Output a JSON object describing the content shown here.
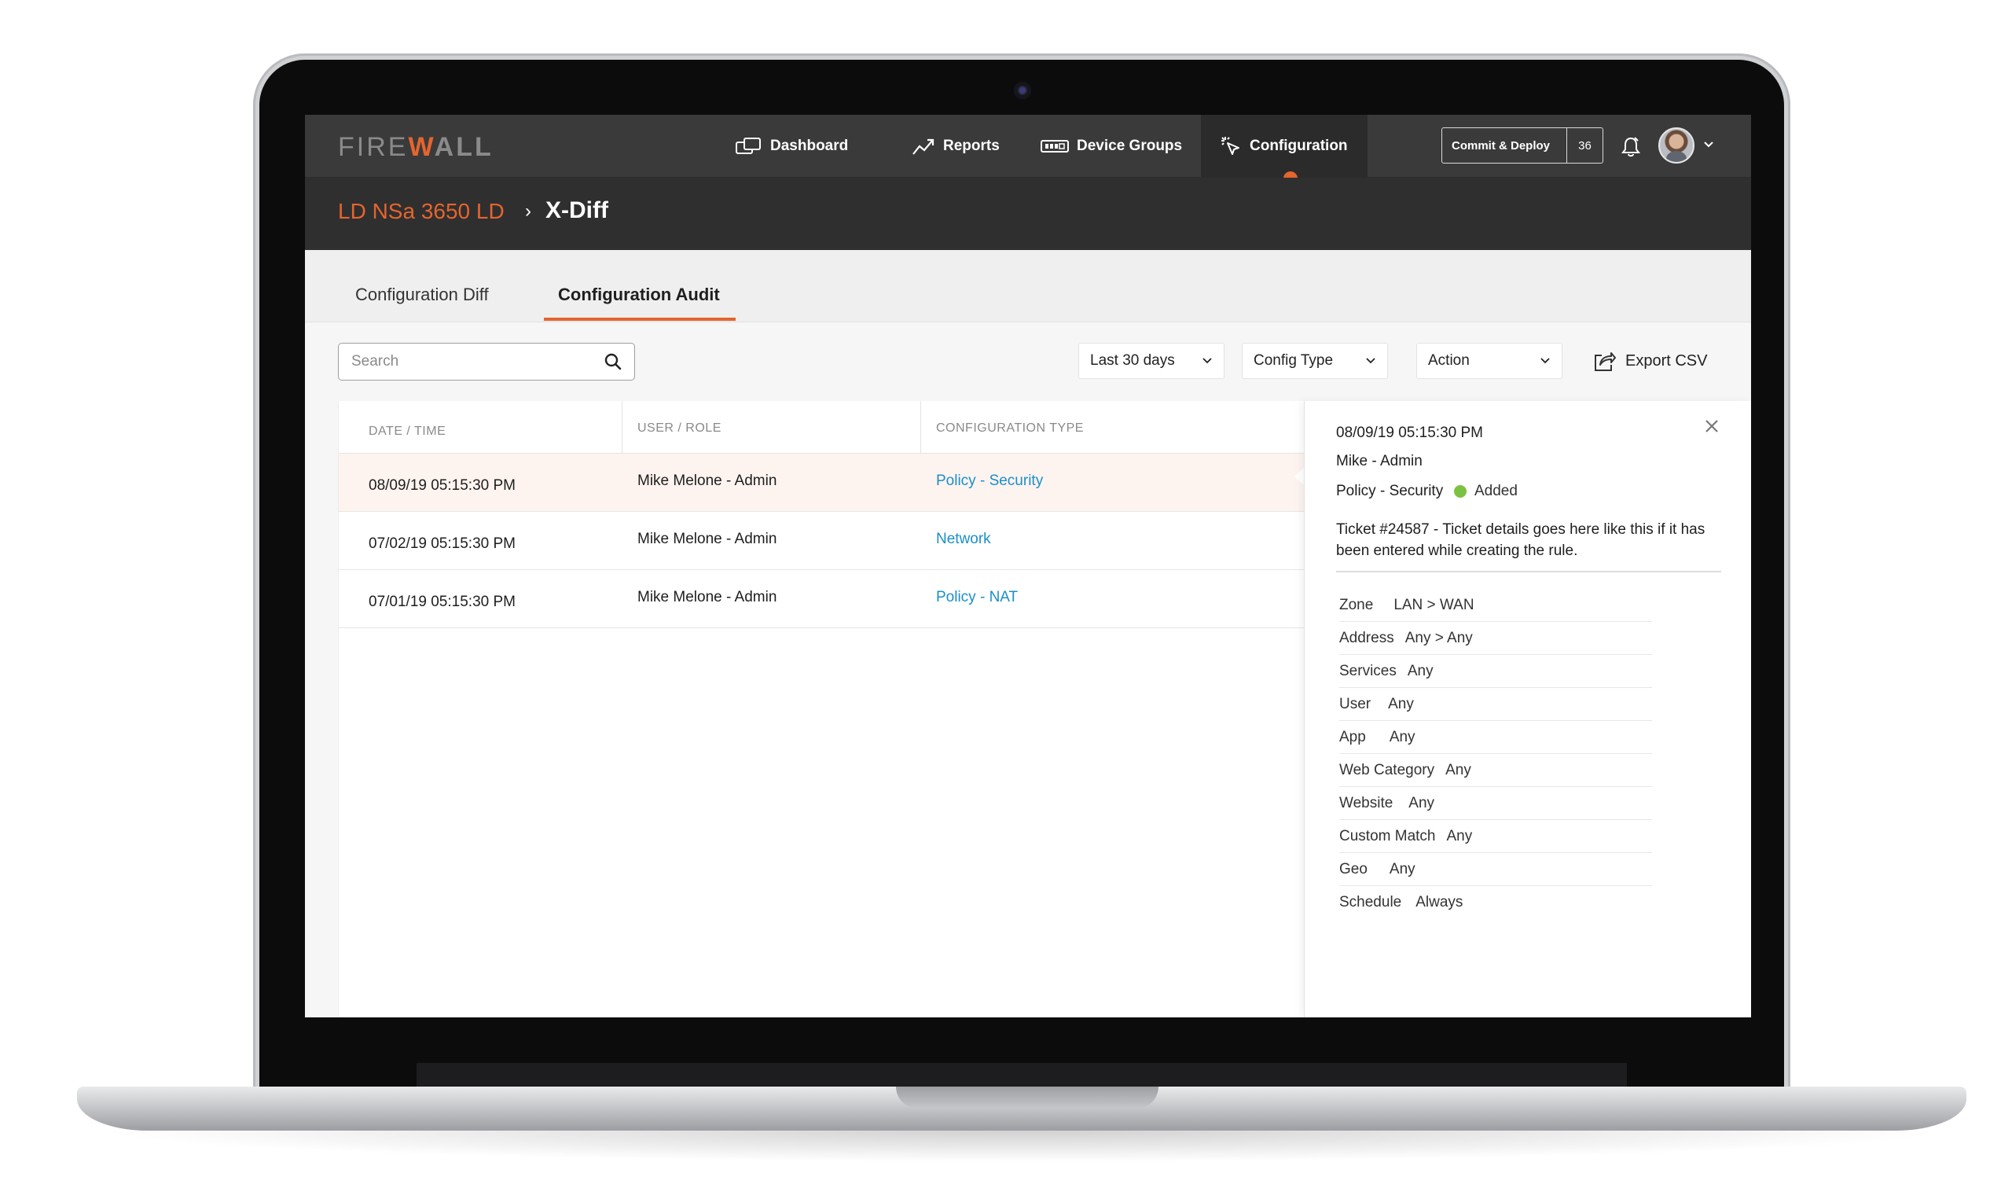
{
  "app": {
    "logo_light": "FIRE",
    "logo_accent": "W",
    "logo_bold": "ALL"
  },
  "nav": {
    "items": [
      {
        "label": "Dashboard",
        "icon": "dashboard-icon"
      },
      {
        "label": "Reports",
        "icon": "trend-chart-icon"
      },
      {
        "label": "Device Groups",
        "icon": "device-groups-icon"
      },
      {
        "label": "Configuration",
        "icon": "configuration-icon",
        "active": true
      }
    ],
    "commit_label": "Commit & Deploy",
    "commit_count": "36"
  },
  "breadcrumb": {
    "device": "LD NSa 3650 LD",
    "separator": "›",
    "page": "X-Diff"
  },
  "tabs": [
    {
      "label": "Configuration Diff",
      "active": false
    },
    {
      "label": "Configuration Audit",
      "active": true
    }
  ],
  "filters": {
    "search_placeholder": "Search",
    "date_range": "Last 30 days",
    "config_type": "Config Type",
    "action": "Action",
    "export_label": "Export CSV"
  },
  "table": {
    "columns": [
      "DATE / TIME",
      "USER / ROLE",
      "CONFIGURATION TYPE"
    ],
    "rows": [
      {
        "datetime": "08/09/19  05:15:30 PM",
        "user": "Mike Melone - Admin",
        "type": "Policy - Security",
        "selected": true
      },
      {
        "datetime": "07/02/19  05:15:30 PM",
        "user": "Mike Melone - Admin",
        "type": "Network",
        "selected": false
      },
      {
        "datetime": "07/01/19  05:15:30 PM",
        "user": "Mike Melone - Admin",
        "type": "Policy - NAT",
        "selected": false
      }
    ]
  },
  "detail": {
    "datetime": "08/09/19  05:15:30 PM",
    "user": "Mike - Admin",
    "type": "Policy - Security",
    "status": "Added",
    "status_color": "#7cc242",
    "note": "Ticket #24587 - Ticket details goes here like this if it has been entered while creating the rule.",
    "properties": [
      {
        "key": "Zone",
        "value": "LAN > WAN"
      },
      {
        "key": "Address",
        "value": "Any > Any"
      },
      {
        "key": "Services",
        "value": "Any"
      },
      {
        "key": "User",
        "value": "Any"
      },
      {
        "key": "App",
        "value": "Any"
      },
      {
        "key": "Web Category",
        "value": "Any"
      },
      {
        "key": "Website",
        "value": "Any"
      },
      {
        "key": "Custom Match",
        "value": "Any"
      },
      {
        "key": "Geo",
        "value": "Any"
      },
      {
        "key": "Schedule",
        "value": "Always"
      }
    ]
  },
  "colors": {
    "accent": "#e4652e",
    "link": "#1a8fc9",
    "nav_bg": "#3a3a3a",
    "crumb_bg": "#2f2f2f"
  }
}
